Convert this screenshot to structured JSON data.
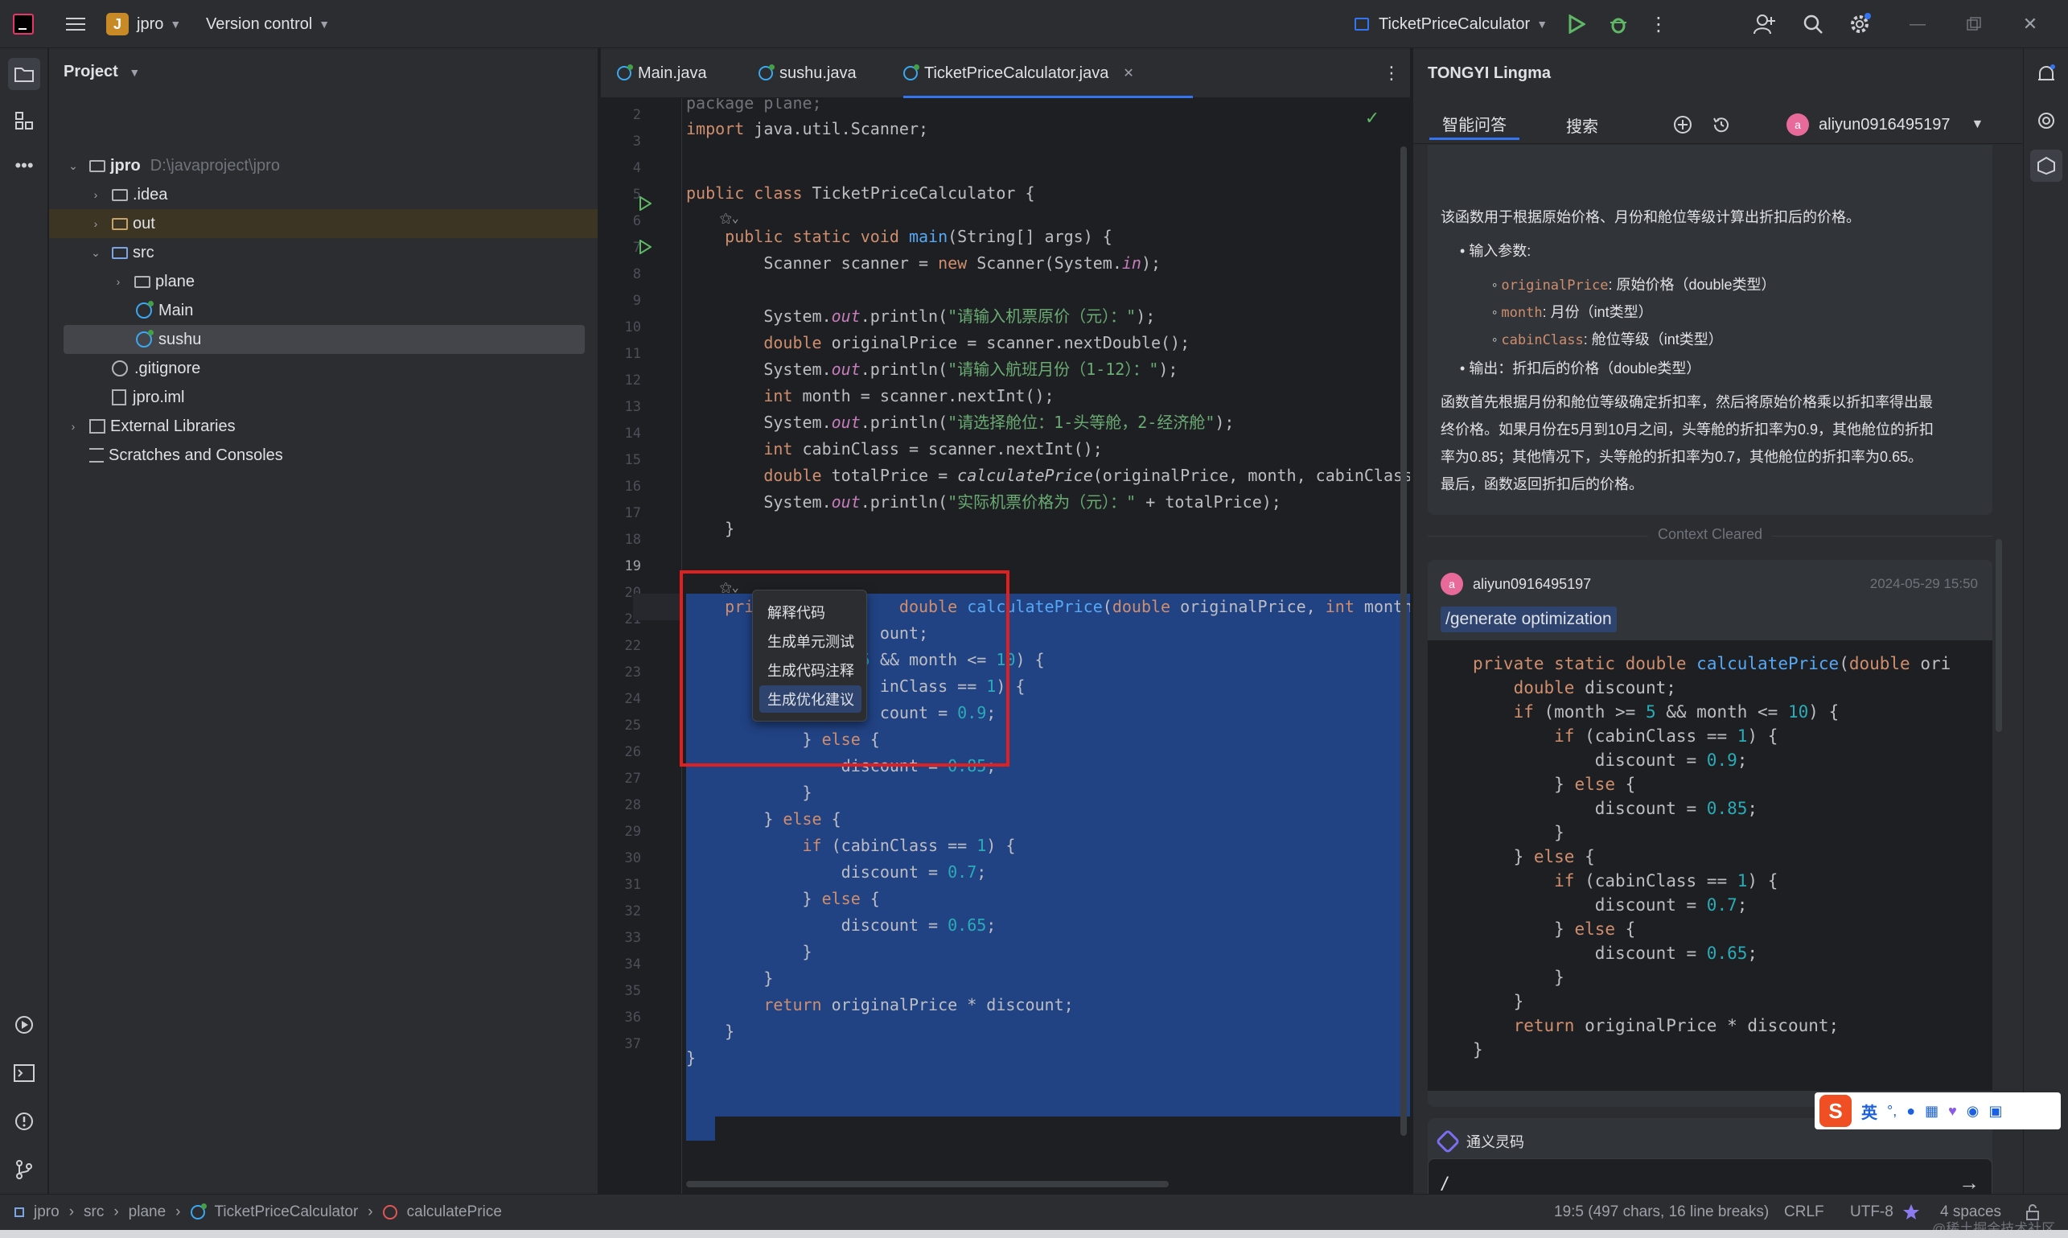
{
  "titlebar": {
    "project_badge": "J",
    "project_name": "jpro",
    "vcs": "Version control",
    "run_config": "TicketPriceCalculator"
  },
  "project_panel": {
    "title": "Project",
    "tree": [
      {
        "label": "jpro",
        "path": "D:\\javaproject\\jpro"
      },
      {
        "label": ".idea"
      },
      {
        "label": "out"
      },
      {
        "label": "src"
      },
      {
        "label": "plane"
      },
      {
        "label": "Main"
      },
      {
        "label": "sushu"
      },
      {
        "label": ".gitignore"
      },
      {
        "label": "jpro.iml"
      },
      {
        "label": "External Libraries"
      },
      {
        "label": "Scratches and Consoles"
      }
    ]
  },
  "editor": {
    "tabs": [
      "Main.java",
      "sushu.java",
      "TicketPriceCalculator.java"
    ],
    "line_numbers": [
      "2",
      "3",
      "4",
      "5",
      "6",
      "7",
      "8",
      "9",
      "10",
      "11",
      "12",
      "13",
      "14",
      "15",
      "16",
      "17",
      "18",
      "19",
      "20",
      "21",
      "22",
      "23",
      "24",
      "25",
      "26",
      "27",
      "28",
      "29",
      "30",
      "31",
      "32",
      "33",
      "34",
      "35",
      "36",
      "37"
    ],
    "context_menu": [
      "解释代码",
      "生成单元测试",
      "生成代码注释",
      "生成优化建议"
    ]
  },
  "assistant": {
    "title": "TONGYI Lingma",
    "tabs": [
      "智能问答",
      "搜索"
    ],
    "user": "aliyun0916495197",
    "explain": {
      "intro": "该函数用于根据原始价格、月份和舱位等级计算出折扣后的价格。",
      "input_label": "输入参数:",
      "params": [
        {
          "name": "originalPrice",
          "desc": ": 原始价格（double类型）"
        },
        {
          "name": "month",
          "desc": ": 月份（int类型）"
        },
        {
          "name": "cabinClass",
          "desc": ": 舱位等级（int类型）"
        }
      ],
      "output": "输出：折扣后的价格（double类型）",
      "para": [
        "函数首先根据月份和舱位等级确定折扣率，然后将原始价格乘以折扣率得出最",
        "终价格。如果月份在5月到10月之间，头等舱的折扣率为0.9，其他舱位的折扣",
        "率为0.85；其他情况下，头等舱的折扣率为0.7，其他舱位的折扣率为0.65。",
        "最后，函数返回折扣后的价格。"
      ]
    },
    "context_cleared": "Context Cleared",
    "message": {
      "user": "aliyun0916495197",
      "time": "2024-05-29 15:50",
      "command": "/generate optimization"
    },
    "footer_brand": "通义灵码",
    "input_value": "/"
  },
  "status": {
    "breadcrumb": [
      "jpro",
      "src",
      "plane",
      "TicketPriceCalculator",
      "calculatePrice"
    ],
    "position": "19:5 (497 chars, 16 line breaks)",
    "line_sep": "CRLF",
    "encoding": "UTF-8",
    "indent": "4 spaces",
    "watermark": "@稀土掘金技术社区"
  },
  "ime": {
    "lang": "英"
  },
  "colors": {
    "accent": "#3574f0",
    "selection": "#214283",
    "highlight_box": "#e02020"
  }
}
